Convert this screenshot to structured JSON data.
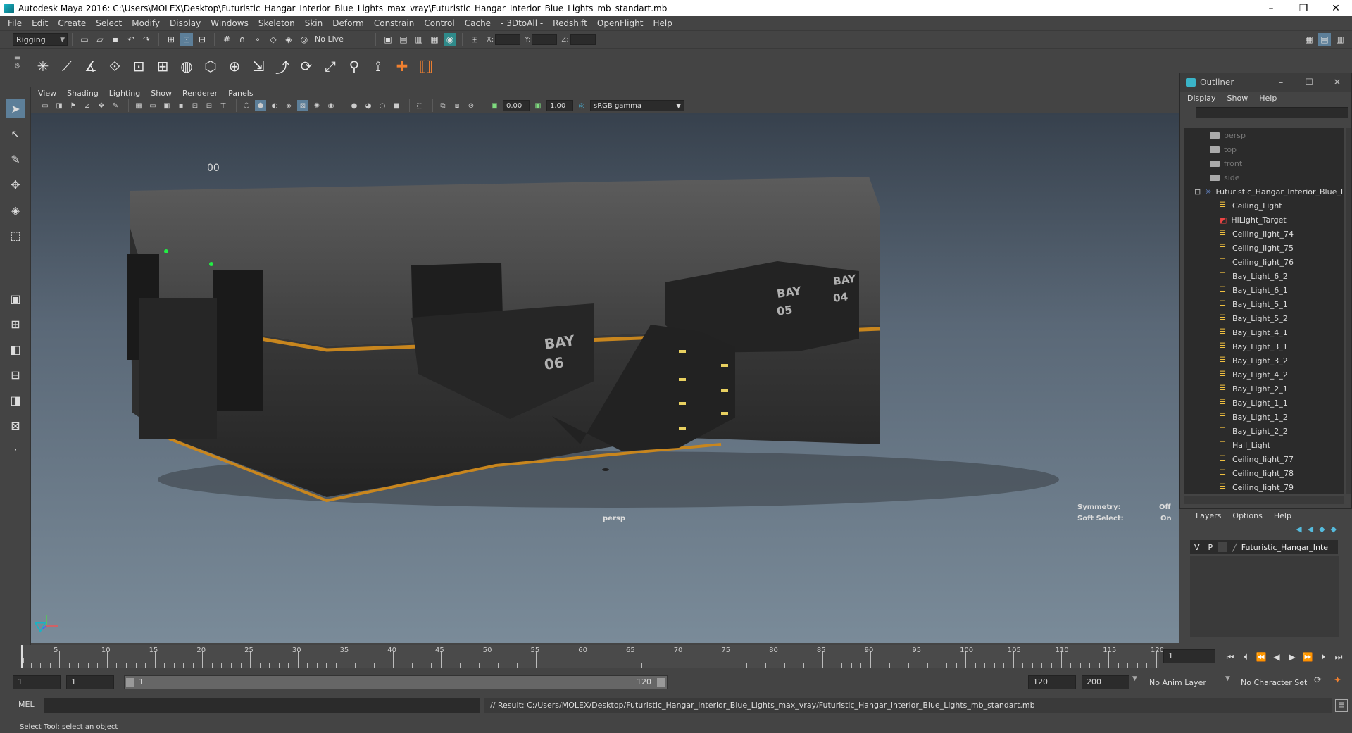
{
  "window": {
    "title": "Autodesk Maya 2016: C:\\Users\\MOLEX\\Desktop\\Futuristic_Hangar_Interior_Blue_Lights_max_vray\\Futuristic_Hangar_Interior_Blue_Lights_mb_standart.mb",
    "minimize": "–",
    "restore": "❐",
    "close": "✕"
  },
  "menubar": [
    "File",
    "Edit",
    "Create",
    "Select",
    "Modify",
    "Display",
    "Windows",
    "Skeleton",
    "Skin",
    "Deform",
    "Constrain",
    "Control",
    "Cache",
    "- 3DtoAll -",
    "Redshift",
    "OpenFlight",
    "Help"
  ],
  "statusline": {
    "menuset": "Rigging",
    "live_surface": "No Live Surface",
    "x_label": "X:",
    "y_label": "Y:",
    "z_label": "Z:"
  },
  "panel": {
    "menus": [
      "View",
      "Shading",
      "Lighting",
      "Show",
      "Renderer",
      "Panels"
    ],
    "exposure": "0.00",
    "gamma": "1.00",
    "colorspace": "sRGB gamma"
  },
  "viewport": {
    "camera": "persp",
    "symmetry_label": "Symmetry:",
    "symmetry_value": "Off",
    "softselect_label": "Soft Select:",
    "softselect_value": "On",
    "bay_a_1": "BAY",
    "bay_a_2": "06",
    "bay_b_1": "BAY",
    "bay_b_2": "05",
    "bay_c_1": "BAY",
    "bay_c_2": "04",
    "hull_text": "00"
  },
  "outliner": {
    "title": "Outliner",
    "menus": [
      "Display",
      "Show",
      "Help"
    ],
    "items": [
      {
        "label": "persp",
        "kind": "camera"
      },
      {
        "label": "top",
        "kind": "camera"
      },
      {
        "label": "front",
        "kind": "camera"
      },
      {
        "label": "side",
        "kind": "camera"
      },
      {
        "label": "Futuristic_Hangar_Interior_Blue_L",
        "kind": "group"
      },
      {
        "label": "Ceiling_Light",
        "kind": "light"
      },
      {
        "label": "HiLight_Target",
        "kind": "target"
      },
      {
        "label": "Ceiling_light_74",
        "kind": "light"
      },
      {
        "label": "Ceiling_light_75",
        "kind": "light"
      },
      {
        "label": "Ceiling_light_76",
        "kind": "light"
      },
      {
        "label": "Bay_Light_6_2",
        "kind": "light"
      },
      {
        "label": "Bay_Light_6_1",
        "kind": "light"
      },
      {
        "label": "Bay_Light_5_1",
        "kind": "light"
      },
      {
        "label": "Bay_Light_5_2",
        "kind": "light"
      },
      {
        "label": "Bay_Light_4_1",
        "kind": "light"
      },
      {
        "label": "Bay_Light_3_1",
        "kind": "light"
      },
      {
        "label": "Bay_Light_3_2",
        "kind": "light"
      },
      {
        "label": "Bay_Light_4_2",
        "kind": "light"
      },
      {
        "label": "Bay_Light_2_1",
        "kind": "light"
      },
      {
        "label": "Bay_Light_1_1",
        "kind": "light"
      },
      {
        "label": "Bay_Light_1_2",
        "kind": "light"
      },
      {
        "label": "Bay_Light_2_2",
        "kind": "light"
      },
      {
        "label": "Hall_Light",
        "kind": "light"
      },
      {
        "label": "Ceiling_light_77",
        "kind": "light"
      },
      {
        "label": "Ceiling_light_78",
        "kind": "light"
      },
      {
        "label": "Ceiling_light_79",
        "kind": "light"
      }
    ]
  },
  "layers": {
    "menus": [
      "Layers",
      "Options",
      "Help"
    ],
    "row": {
      "v": "V",
      "p": "P",
      "name": "Futuristic_Hangar_Inte"
    }
  },
  "timeline": {
    "ticks": [
      "5",
      "10",
      "15",
      "20",
      "25",
      "30",
      "35",
      "40",
      "45",
      "50",
      "55",
      "60",
      "65",
      "70",
      "75",
      "80",
      "85",
      "90",
      "95",
      "100",
      "105",
      "110",
      "115",
      "120"
    ],
    "start_label": "1",
    "current_frame": "1"
  },
  "range": {
    "start": "1",
    "playback_start": "1",
    "bar_start": "1",
    "bar_end": "120",
    "playback_end": "120",
    "end": "200",
    "anim_layer": "No Anim Layer",
    "character_set": "No Character Set"
  },
  "cmdline": {
    "mel": "MEL",
    "result": "// Result: C:/Users/MOLEX/Desktop/Futuristic_Hangar_Interior_Blue_Lights_max_vray/Futuristic_Hangar_Interior_Blue_Lights_mb_standart.mb"
  },
  "helpline": "Select Tool: select an object",
  "colors": {
    "accent": "#5d7f99",
    "stripe": "#c8861e",
    "viewport_top": "#37414d",
    "viewport_bottom": "#7a8b99"
  }
}
